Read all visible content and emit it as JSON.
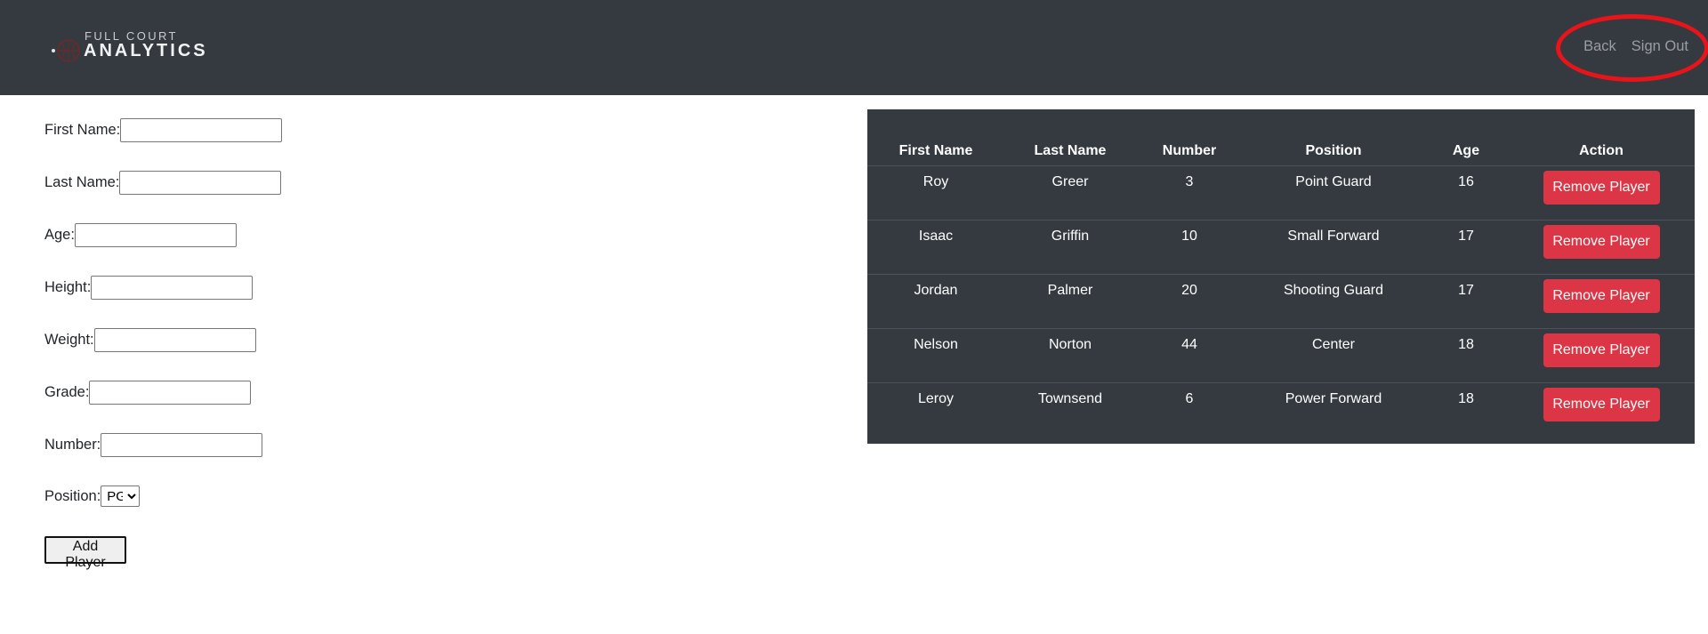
{
  "brand": {
    "small_text": "FULL COURT",
    "big_text": "ANALYTICS"
  },
  "nav": {
    "back_label": "Back",
    "signout_label": "Sign Out"
  },
  "form": {
    "first_name_label": "First Name:",
    "last_name_label": "Last Name:",
    "age_label": "Age:",
    "height_label": "Height:",
    "weight_label": "Weight:",
    "grade_label": "Grade:",
    "number_label": "Number:",
    "position_label": "Position:",
    "position_value": "PG",
    "add_button_label": "Add Player"
  },
  "table": {
    "headers": [
      "First Name",
      "Last Name",
      "Number",
      "Position",
      "Age",
      "Action"
    ],
    "action_label": "Remove Player",
    "rows": [
      {
        "first": "Roy",
        "last": "Greer",
        "number": "3",
        "position": "Point Guard",
        "age": "16"
      },
      {
        "first": "Isaac",
        "last": "Griffin",
        "number": "10",
        "position": "Small Forward",
        "age": "17"
      },
      {
        "first": "Jordan",
        "last": "Palmer",
        "number": "20",
        "position": "Shooting Guard",
        "age": "17"
      },
      {
        "first": "Nelson",
        "last": "Norton",
        "number": "44",
        "position": "Center",
        "age": "18"
      },
      {
        "first": "Leroy",
        "last": "Townsend",
        "number": "6",
        "position": "Power Forward",
        "age": "18"
      }
    ]
  },
  "colors": {
    "navbar": "#343a40",
    "table_bg": "#343a40",
    "danger": "#dc3545",
    "highlight": "#e8141a"
  }
}
